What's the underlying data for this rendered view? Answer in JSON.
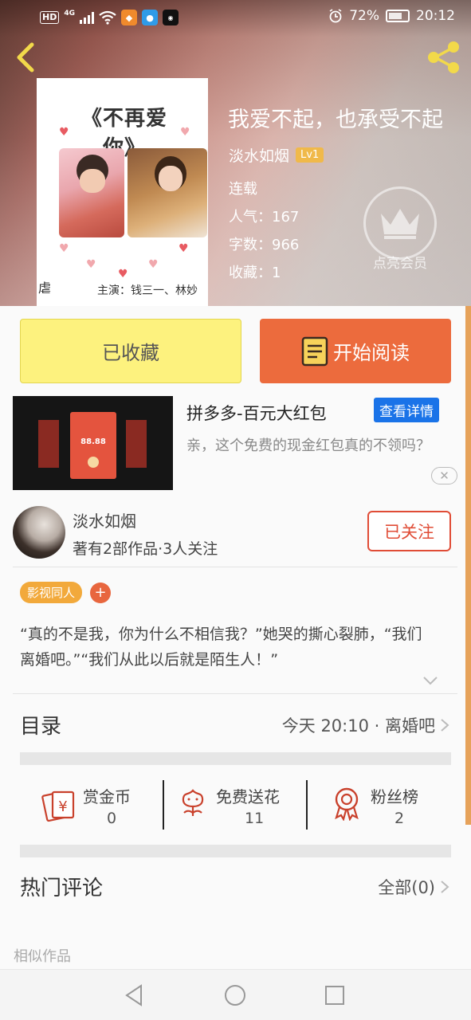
{
  "status_bar": {
    "hd": "HD",
    "network": "4G",
    "battery_percent": "72%",
    "battery_level": 0.72,
    "time": "20:12"
  },
  "book": {
    "title": "我爱不起，也承受不起",
    "author": "淡水如烟",
    "level": "Lv1",
    "status": "连载",
    "popularity": "人气：167",
    "word_count": "字数：966",
    "favorites": "收藏：1",
    "vip_label": "点亮会员"
  },
  "cover": {
    "title": "《不再爱你》",
    "cast": "主演：钱三一、林妙",
    "mark": "虐"
  },
  "buttons": {
    "collected": "已收藏",
    "start_reading": "开始阅读"
  },
  "ad": {
    "title": "拼多多-百元大红包",
    "cta": "查看详情",
    "description": "亲，这个免费的现金红包真的不领吗？",
    "card_amount": "88.88",
    "close_glyph": "✕"
  },
  "author_card": {
    "name": "淡水如烟",
    "info": "著有2部作品·3人关注",
    "follow_label": "已关注"
  },
  "tags": {
    "items": [
      "影视同人"
    ],
    "add": "+"
  },
  "synopsis": "“真的不是我，你为什么不相信我？”她哭的撕心裂肺，“我们离婚吧。”“我们从此以后就是陌生人！”",
  "catalog": {
    "label": "目录",
    "latest": "今天 20:10 · 离婚吧"
  },
  "actions": {
    "reward": {
      "label": "赏金币",
      "count": "0"
    },
    "flower": {
      "label": "免费送花",
      "count": "11"
    },
    "fans": {
      "label": "粉丝榜",
      "count": "2"
    }
  },
  "comments": {
    "label": "热门评论",
    "all": "全部(0)"
  },
  "similar_label": "相似作品",
  "colors": {
    "accent_orange": "#ec6b3d",
    "collect_yellow": "#fdf27e",
    "follow_red": "#e04c36",
    "tag_yellow": "#f2a93b",
    "ad_blue": "#1a73e8"
  },
  "icons": [
    "back-icon",
    "share-icon",
    "crown-icon",
    "book-icon",
    "reward-coin-icon",
    "flower-icon",
    "medal-icon",
    "chevron-right-icon",
    "chevron-down-icon",
    "nav-back-icon",
    "nav-home-icon",
    "nav-recent-icon"
  ]
}
